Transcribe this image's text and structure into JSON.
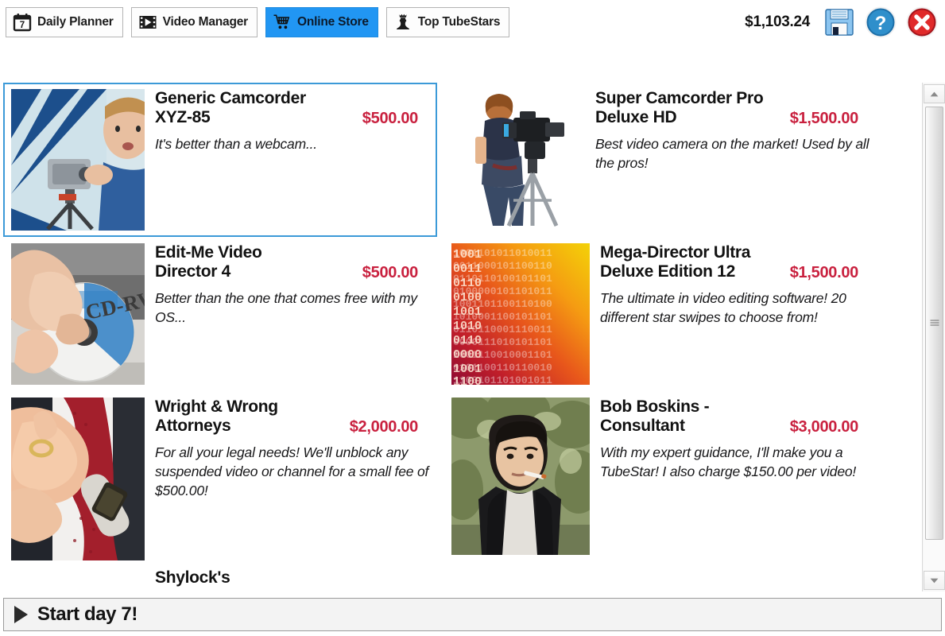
{
  "toolbar": {
    "tabs": [
      {
        "label": "Daily Planner",
        "icon": "calendar-icon",
        "active": false,
        "badge": "7"
      },
      {
        "label": "Video Manager",
        "icon": "film-strip-icon",
        "active": false
      },
      {
        "label": "Online Store",
        "icon": "shopping-cart-icon",
        "active": true
      },
      {
        "label": "Top TubeStars",
        "icon": "chess-queen-icon",
        "active": false
      }
    ],
    "money": "$1,103.24",
    "window_buttons": [
      {
        "name": "save-button",
        "icon": "floppy-disk-icon"
      },
      {
        "name": "help-button",
        "icon": "question-mark-icon"
      },
      {
        "name": "close-button",
        "icon": "close-x-icon"
      }
    ]
  },
  "store": {
    "items": [
      {
        "title": "Generic Camcorder XYZ-85",
        "price": "$500.00",
        "description": "It's better than a webcam...",
        "selected": true,
        "thumb": "camcorder-blue-backdrop"
      },
      {
        "title": "Super Camcorder Pro Deluxe HD",
        "price": "$1,500.00",
        "description": "Best video camera on the market! Used by all the pros!",
        "selected": false,
        "thumb": "pro-camera-operator"
      },
      {
        "title": "Edit-Me Video Director 4",
        "price": "$500.00",
        "description": "Better than the one that comes free with my OS...",
        "selected": false,
        "thumb": "cd-rw-disc-hand"
      },
      {
        "title": "Mega-Director Ultra Deluxe Edition 12",
        "price": "$1,500.00",
        "description": "The ultimate in video editing software! 20 different star swipes to choose from!",
        "selected": false,
        "thumb": "binary-code-orange"
      },
      {
        "title": "Wright & Wrong Attorneys",
        "price": "$2,000.00",
        "description": "For all your legal needs! We'll unblock any suspended video or channel for a small fee of $500.00!",
        "selected": false,
        "thumb": "suit-tie-watch-hand"
      },
      {
        "title": "Bob Boskins - Consultant",
        "price": "$3,000.00",
        "description": "With my expert guidance, I'll make you a TubeStar! I also charge $150.00 per video!",
        "selected": false,
        "thumb": "man-cigarette-portrait"
      },
      {
        "title": "Shylock's",
        "price": "",
        "description": "",
        "selected": false,
        "thumb": "partially-visible"
      }
    ]
  },
  "statusbar": {
    "label": "Start day 7!",
    "icon": "play-triangle-icon"
  },
  "colors": {
    "accent_blue": "#2196f3",
    "selection_blue": "#3c9ad8",
    "price_red": "#c9213f",
    "text_dark": "#141414"
  }
}
